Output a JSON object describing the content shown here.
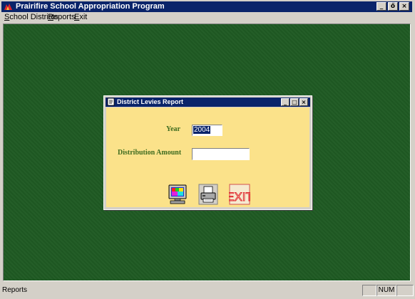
{
  "app": {
    "title": "Prairifire School Appropriation Program",
    "controls": {
      "minimize": "_",
      "restore": "ő",
      "close": "×"
    }
  },
  "menu": {
    "items": [
      {
        "label": "School Districts",
        "mnemonic": "S",
        "rest": "chool Districts"
      },
      {
        "label": "Reports",
        "mnemonic": "R",
        "rest": "eports"
      },
      {
        "label": "Exit",
        "mnemonic": "E",
        "rest": "xit"
      }
    ]
  },
  "dialog": {
    "title": "District Levies Report",
    "year_label": "Year",
    "year_value": "2004",
    "distribution_label": "Distribution Amount",
    "distribution_value": "",
    "buttons": {
      "preview_icon": "monitor-icon",
      "print_icon": "printer-icon",
      "exit_label": "EXIT"
    },
    "controls": {
      "minimize": "_",
      "maximize": "□",
      "close": "×"
    }
  },
  "statusbar": {
    "text": "Reports",
    "num": "NUM"
  },
  "colors": {
    "title_bar": "#0a246a",
    "mdi_background": "#1f5a23",
    "dialog_body": "#fbe28a",
    "label_text": "#3d6b1f",
    "exit_red": "#e0242a"
  }
}
